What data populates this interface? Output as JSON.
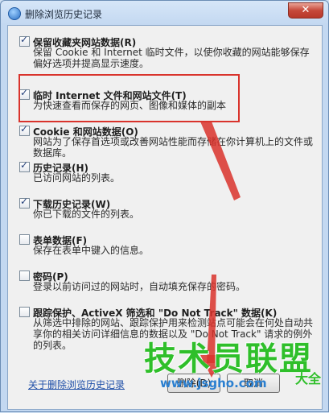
{
  "window": {
    "title": "删除浏览历史记录",
    "close_label": "✕"
  },
  "items": [
    {
      "label": "保留收藏夹网站数据(R)",
      "desc": "保留 Cookie 和 Internet 临时文件，以使你收藏的网站能够保存偏好选项并提高显示速度。",
      "checked": true
    },
    {
      "label": "临时 Internet 文件和网站文件(T)",
      "desc": "为快速查看而保存的网页、图像和媒体的副本",
      "checked": true
    },
    {
      "label": "Cookie 和网站数据(O)",
      "desc": "网站为了保存首选项或改善网站性能而存储在你计算机上的文件或数据库。",
      "checked": true
    },
    {
      "label": "历史记录(H)",
      "desc": "已访问网站的列表。",
      "checked": true
    },
    {
      "label": "下载历史记录(W)",
      "desc": "你已下载的文件的列表。",
      "checked": true
    },
    {
      "label": "表单数据(F)",
      "desc": "保存在表单中键入的信息。",
      "checked": false
    },
    {
      "label": "密码(P)",
      "desc": "登录以前访问过的网站时，自动填充保存的密码。",
      "checked": false
    },
    {
      "label": "跟踪保护、ActiveX 筛选和 \"Do Not Track\" 数据(K)",
      "desc": "从筛选中排除的网站、跟踪保护用来检测站点可能会在何处自动共享你的相关访问详细信息的数据以及 \"Do Not Track\" 请求的例外的列表。",
      "checked": false
    }
  ],
  "footer": {
    "about_link": "关于删除浏览历史记录",
    "delete_label": "删除(D)",
    "cancel_label": "取消"
  },
  "watermark": {
    "brand": "技术员联盟",
    "url": "www.jsgho.com",
    "side": "大全"
  },
  "colors": {
    "annotation_red": "#d9332c",
    "watermark_green": "#2fbf2a",
    "watermark_blue": "#2a7fd0"
  }
}
